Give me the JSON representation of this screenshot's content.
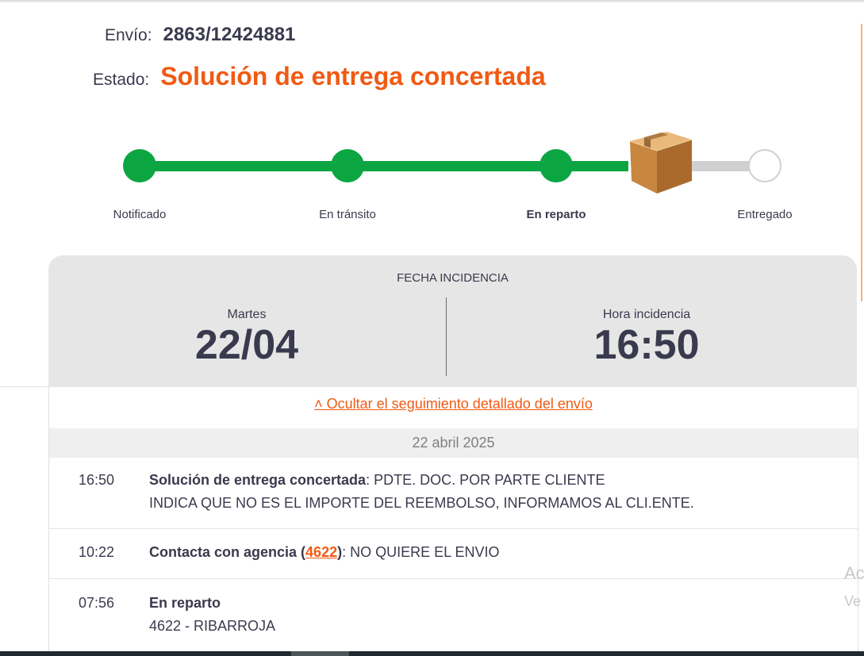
{
  "shipment": {
    "label": "Envío:",
    "number": "2863/12424881",
    "status_label": "Estado:",
    "status_value": "Solución de entrega concertada"
  },
  "progress": {
    "steps": [
      {
        "label": "Notificado",
        "state": "done"
      },
      {
        "label": "En tránsito",
        "state": "done"
      },
      {
        "label": "En reparto",
        "state": "current"
      },
      {
        "label": "Entregado",
        "state": "pending"
      }
    ],
    "colors": {
      "done": "#0ba642",
      "pending": "#d0d0d0",
      "accent": "#f05a14"
    }
  },
  "incident": {
    "title": "FECHA INCIDENCIA",
    "day_label": "Martes",
    "date": "22/04",
    "time_label": "Hora incidencia",
    "time": "16:50"
  },
  "tracking": {
    "toggle_label": "˄ Ocultar el seguimiento detallado del envío",
    "date_header": "22 abril 2025",
    "events": [
      {
        "time": "16:50",
        "title": "Solución de entrega concertada",
        "text": ": PDTE. DOC. POR PARTE CLIENTE",
        "line2": "INDICA QUE NO ES EL IMPORTE DEL REEMBOLSO, INFORMAMOS AL CLI.ENTE."
      },
      {
        "time": "10:22",
        "title": "Contacta con agencia (",
        "agency": "4622",
        "title_end": ")",
        "text": ": NO QUIERE EL ENVIO"
      },
      {
        "time": "07:56",
        "title": "En reparto",
        "line2": "4622 - RIBARROJA"
      }
    ]
  },
  "side": {
    "t1": "Ac",
    "t2": "Ve"
  }
}
